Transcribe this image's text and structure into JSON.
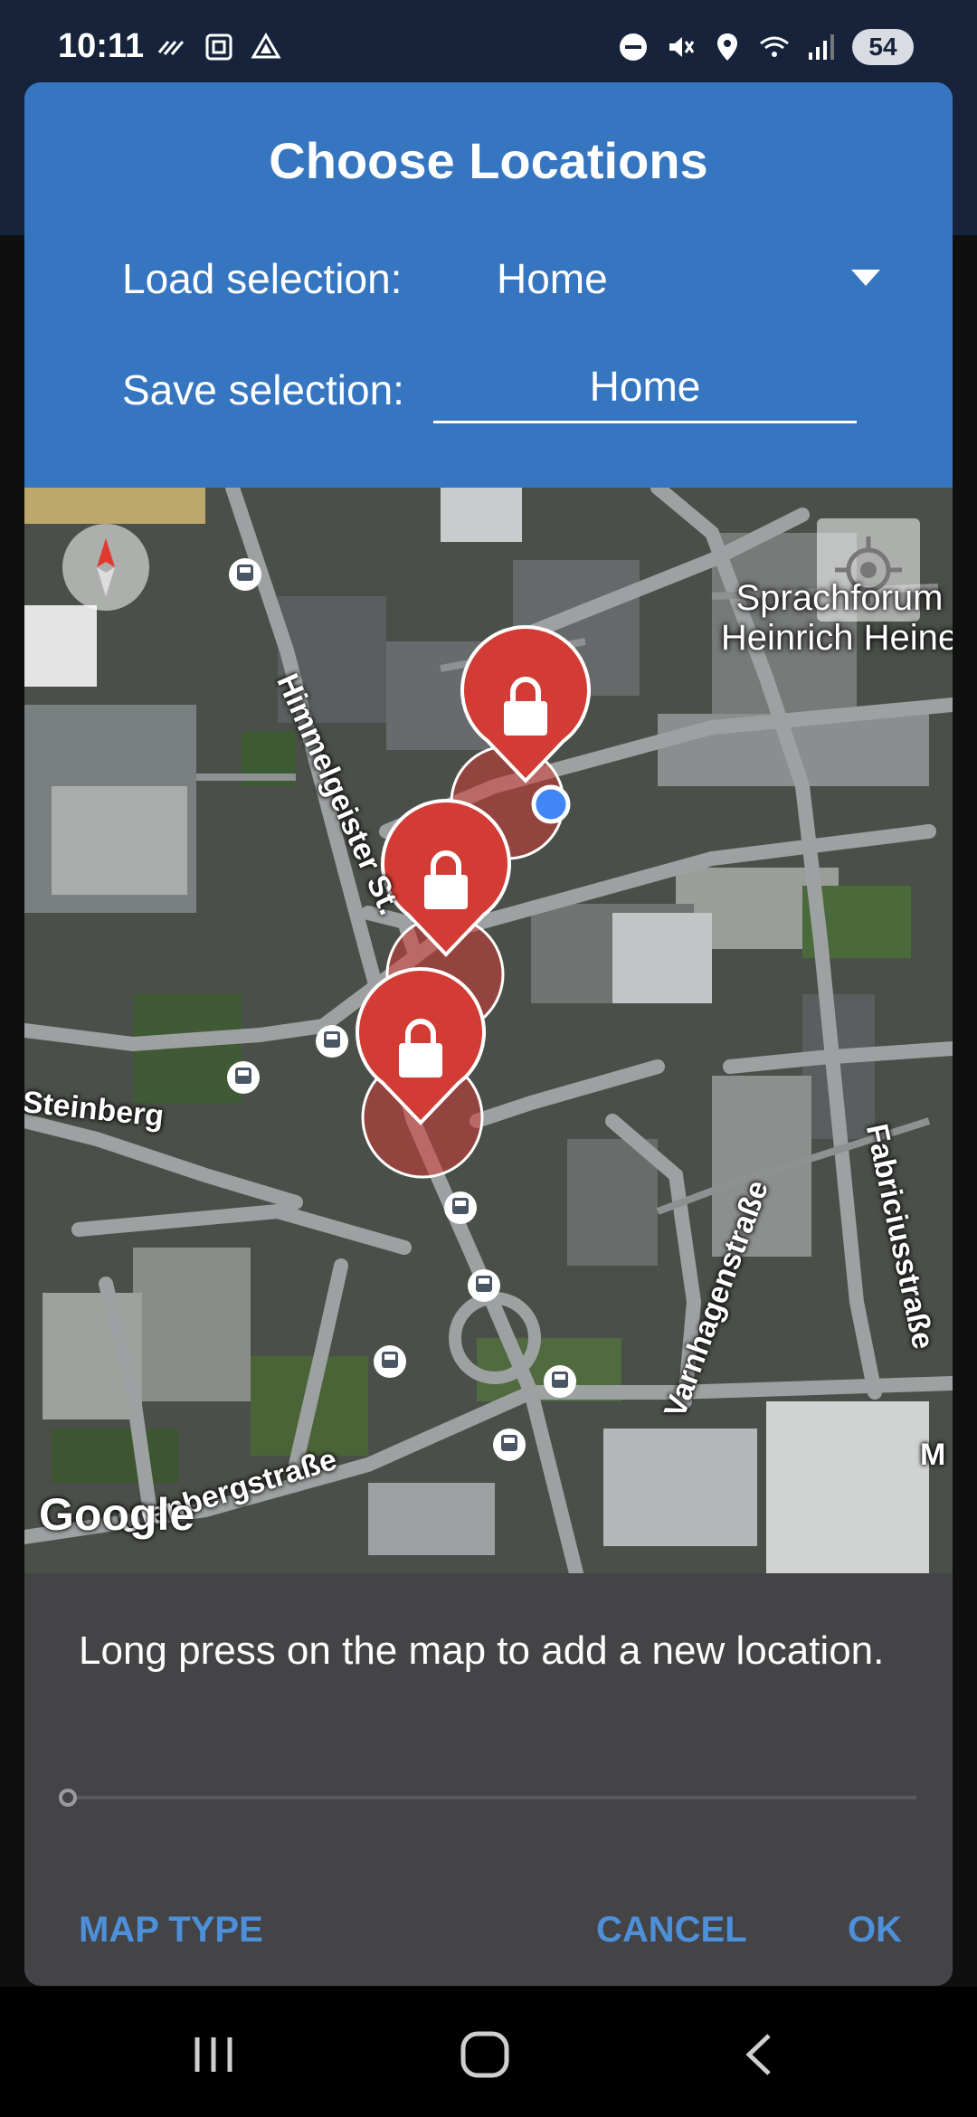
{
  "status_bar": {
    "time": "10:11",
    "battery": "54",
    "left_icons": [
      "voicemail-icon",
      "screenshot-icon",
      "drive-icon"
    ],
    "right_icons": [
      "do-not-disturb-icon",
      "mute-icon",
      "location-icon",
      "wifi-icon",
      "signal-icon"
    ]
  },
  "dialog": {
    "title": "Choose Locations",
    "load_label": "Load selection:",
    "load_value": "Home",
    "save_label": "Save selection:",
    "save_value": "Home"
  },
  "map": {
    "poi": "Sprachforum\nHeinrich Heine",
    "streets": {
      "himmelgeister": "Himmelgeister St.",
      "steinberg": "Steinberg",
      "varnhagen": "Varnhagenstraße",
      "fabricius": "Fabriciusstraße",
      "ulenberg": "Ulenbergstraße",
      "edge": "M"
    },
    "logo": "Google",
    "markers": [
      {
        "name": "location-1",
        "icon": "lock-icon",
        "color": "#d23c34"
      },
      {
        "name": "location-2",
        "icon": "lock-icon",
        "color": "#d23c34"
      },
      {
        "name": "location-3",
        "icon": "lock-icon",
        "color": "#d23c34"
      }
    ]
  },
  "help_text": "Long press on the map to add a new location.",
  "buttons": {
    "map_type": "MAP TYPE",
    "cancel": "CANCEL",
    "ok": "OK"
  },
  "colors": {
    "header": "#3676c1",
    "accent": "#4e8fd9",
    "marker": "#d23c34",
    "dialog_bg": "#444446"
  },
  "nav_bar": [
    "recents-icon",
    "home-icon",
    "back-icon"
  ]
}
